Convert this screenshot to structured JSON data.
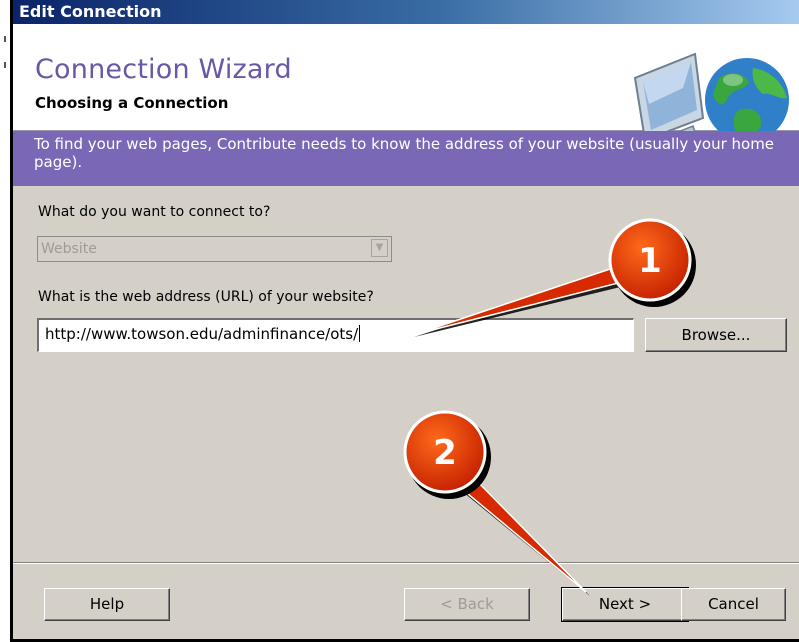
{
  "window": {
    "title": "Edit Connection"
  },
  "header": {
    "title": "Connection Wizard",
    "subtitle": "Choosing a Connection",
    "icons": [
      "computer-monitor-icon",
      "globe-icon"
    ]
  },
  "banner": {
    "text": "To find your web pages, Contribute needs to know the address of your website (usually your home page)."
  },
  "form": {
    "connect_label": "What do you want to connect to?",
    "connect_value": "Website",
    "url_label": "What is the web address (URL) of your website?",
    "url_value": "http://www.towson.edu/adminfinance/ots/",
    "browse_label": "Browse..."
  },
  "footer": {
    "help_label": "Help",
    "back_label": "< Back",
    "next_label": "Next >",
    "cancel_label": "Cancel"
  },
  "annotations": {
    "step1": "1",
    "step2": "2",
    "color": "#d72a00"
  },
  "colors": {
    "titlebar": "#0a246a",
    "wizard_title": "#6a58a6",
    "banner": "#7a68b6",
    "dialog_bg": "#d4d0c8"
  }
}
